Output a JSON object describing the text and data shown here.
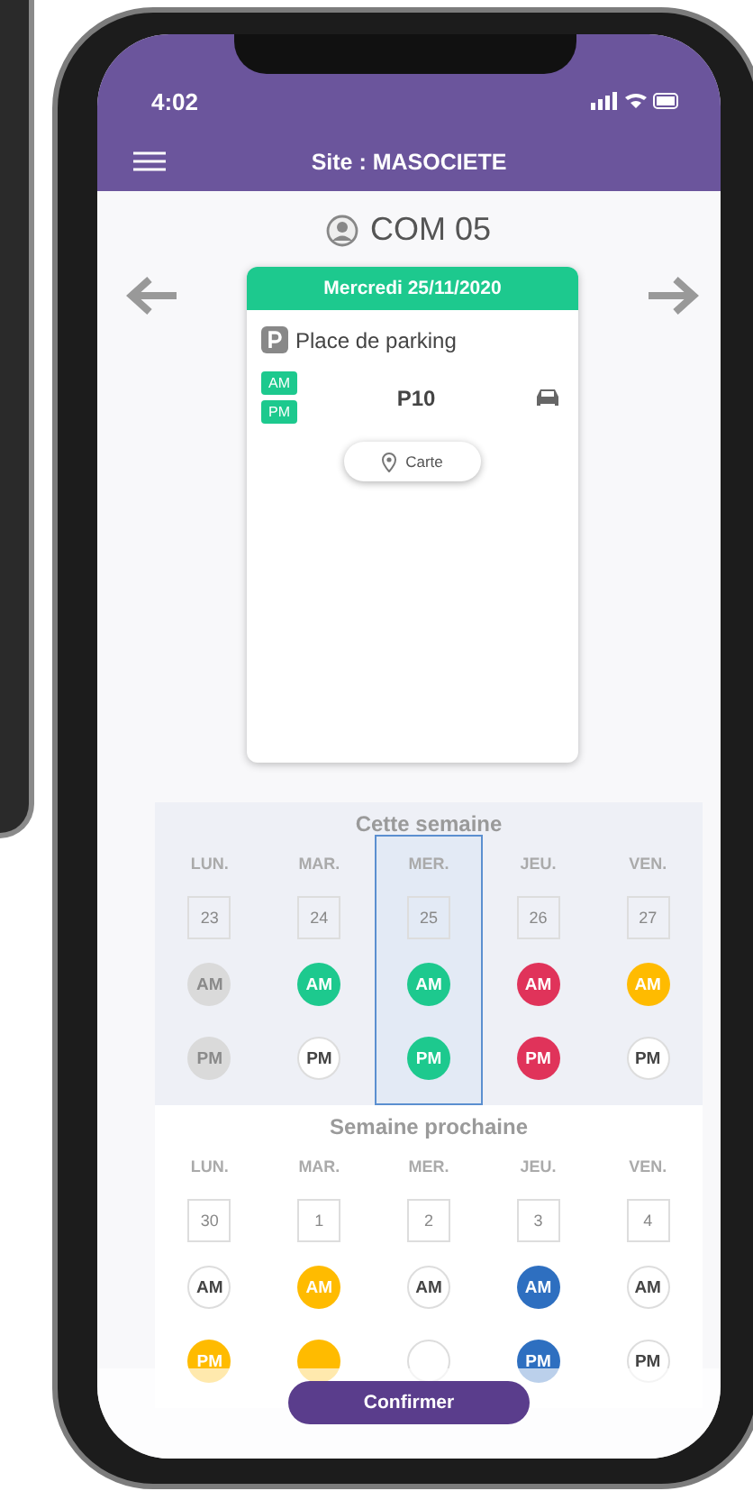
{
  "status_bar": {
    "time": "4:02"
  },
  "header": {
    "title": "Site : MASOCIETE"
  },
  "user": {
    "name": "COM 05"
  },
  "reservation": {
    "date": "Mercredi 25/11/2020",
    "type": "Place de parking",
    "slots": [
      "AM",
      "PM"
    ],
    "spot": "P10",
    "map_button": "Carte"
  },
  "weeks": [
    {
      "title": "Cette semaine",
      "days": [
        {
          "name": "LUN.",
          "date": "23",
          "selected": false,
          "slots": [
            {
              "label": "AM",
              "color": "#dadada"
            },
            {
              "label": "PM",
              "color": "#dadada"
            }
          ]
        },
        {
          "name": "MAR.",
          "date": "24",
          "selected": false,
          "slots": [
            {
              "label": "AM",
              "color": "#1dc98e"
            },
            {
              "label": "PM",
              "color": "#ffffff"
            }
          ]
        },
        {
          "name": "MER.",
          "date": "25",
          "selected": true,
          "slots": [
            {
              "label": "AM",
              "color": "#1dc98e"
            },
            {
              "label": "PM",
              "color": "#1dc98e"
            }
          ]
        },
        {
          "name": "JEU.",
          "date": "26",
          "selected": false,
          "slots": [
            {
              "label": "AM",
              "color": "#e0335a"
            },
            {
              "label": "PM",
              "color": "#e0335a"
            }
          ]
        },
        {
          "name": "VEN.",
          "date": "27",
          "selected": false,
          "slots": [
            {
              "label": "AM",
              "color": "#ffbb00"
            },
            {
              "label": "PM",
              "color": "#ffffff"
            }
          ]
        }
      ]
    },
    {
      "title": "Semaine prochaine",
      "days": [
        {
          "name": "LUN.",
          "date": "30",
          "selected": false,
          "slots": [
            {
              "label": "AM",
              "color": "#ffffff"
            },
            {
              "label": "PM",
              "color": "#ffbb00"
            }
          ]
        },
        {
          "name": "MAR.",
          "date": "1",
          "selected": false,
          "slots": [
            {
              "label": "AM",
              "color": "#ffbb00"
            },
            {
              "color": "#ffbb00"
            }
          ]
        },
        {
          "name": "MER.",
          "date": "2",
          "selected": false,
          "slots": [
            {
              "label": "AM",
              "color": "#ffffff"
            },
            {
              "color": "#ffffff"
            }
          ]
        },
        {
          "name": "JEU.",
          "date": "3",
          "selected": false,
          "slots": [
            {
              "label": "AM",
              "color": "#2e6fc0"
            },
            {
              "label": "PM",
              "color": "#2e6fc0"
            }
          ]
        },
        {
          "name": "VEN.",
          "date": "4",
          "selected": false,
          "slots": [
            {
              "label": "AM",
              "color": "#ffffff"
            },
            {
              "label": "PM",
              "color": "#ffffff"
            }
          ]
        }
      ]
    }
  ],
  "confirm_button": "Confirmer"
}
